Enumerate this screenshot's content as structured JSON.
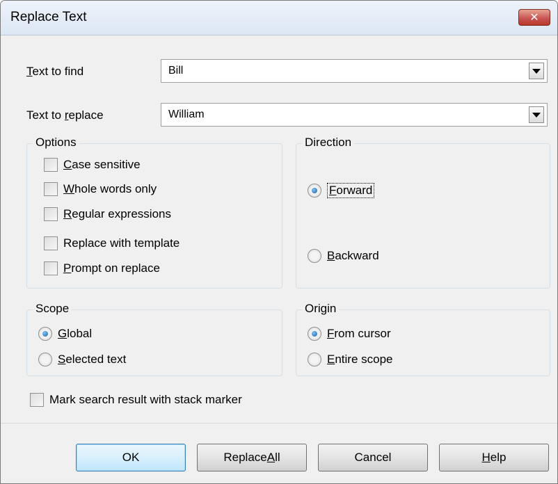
{
  "window": {
    "title": "Replace Text",
    "close_glyph": "✕"
  },
  "find": {
    "label_mnemonic": "T",
    "label_rest": "ext to find",
    "value": "Bill"
  },
  "replace": {
    "label_pre": "Text to ",
    "label_mnemonic": "r",
    "label_rest": "eplace",
    "value": "William"
  },
  "options": {
    "title": "Options",
    "items": [
      {
        "mn": "C",
        "rest": "ase sensitive",
        "checked": false
      },
      {
        "mn": "W",
        "rest": "hole words only",
        "checked": false
      },
      {
        "mn": "R",
        "rest": "egular expressions",
        "checked": false
      },
      {
        "mn": "",
        "rest": "Replace with template",
        "checked": false
      },
      {
        "mn": "P",
        "rest": "rompt on replace",
        "checked": false
      }
    ]
  },
  "direction": {
    "title": "Direction",
    "forward": {
      "mn": "F",
      "rest": "orward",
      "selected": true
    },
    "backward": {
      "mn": "B",
      "rest": "ackward",
      "selected": false
    }
  },
  "scope": {
    "title": "Scope",
    "global": {
      "mn": "G",
      "rest": "lobal",
      "selected": true
    },
    "selected_text": {
      "mn": "S",
      "rest": "elected text",
      "selected": false
    }
  },
  "origin": {
    "title": "Origin",
    "from_cursor": {
      "mn": "F",
      "rest": "rom cursor",
      "selected": true
    },
    "entire_scope": {
      "mn": "E",
      "rest": "ntire scope",
      "selected": false
    }
  },
  "mark": {
    "label": "Mark search result with stack marker",
    "checked": false
  },
  "buttons": {
    "ok": "OK",
    "replace_all_pre": "Replace ",
    "replace_all_mn": "A",
    "replace_all_rest": "ll",
    "cancel": "Cancel",
    "help_mn": "H",
    "help_rest": "elp"
  }
}
